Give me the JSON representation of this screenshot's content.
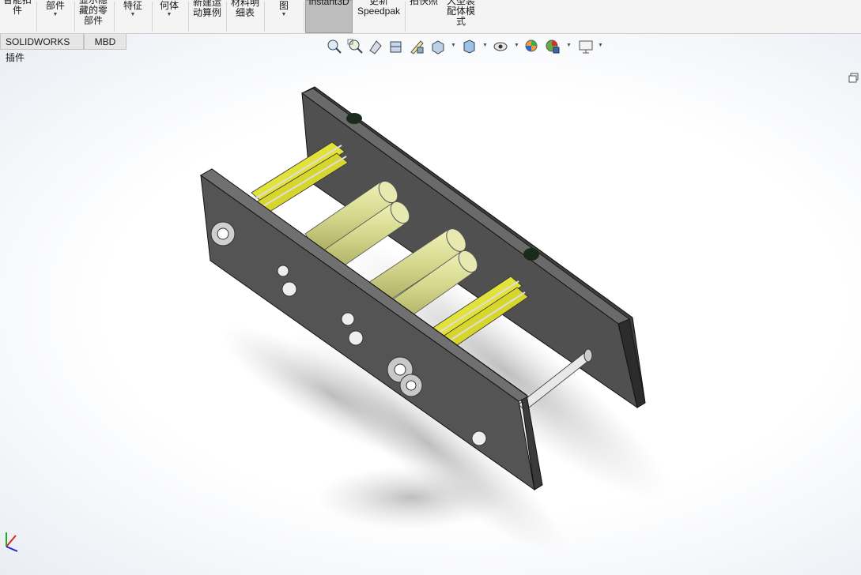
{
  "ribbon": {
    "items": [
      {
        "label": "智能扣\n件",
        "has_arrow": false
      },
      {
        "label": "部件",
        "has_arrow": true
      },
      {
        "label": "显示隐\n藏的零\n部件",
        "has_arrow": false
      },
      {
        "label": "特征",
        "has_arrow": true
      },
      {
        "label": "何体",
        "has_arrow": true
      },
      {
        "label": "新建运\n动算例",
        "has_arrow": false
      },
      {
        "label": "材料明\n细表",
        "has_arrow": false
      },
      {
        "label": "图",
        "has_arrow": true
      },
      {
        "label": "Instant3D",
        "has_arrow": false,
        "active": true
      },
      {
        "label": "更新\nSpeedpak",
        "has_arrow": false
      },
      {
        "label": "拍快照",
        "has_arrow": false
      },
      {
        "label": "大型装\n配体模\n式",
        "has_arrow": false
      }
    ]
  },
  "tabs": [
    {
      "label": "SOLIDWORKS 插件"
    },
    {
      "label": "MBD"
    }
  ],
  "heads_up_toolbar": {
    "icons": [
      "zoom-to-fit-icon",
      "zoom-to-area-icon",
      "previous-view-icon",
      "section-view-icon",
      "dynamic-annotation-icon",
      "view-orientation-icon",
      "display-style-icon",
      "hide-show-items-icon",
      "edit-appearance-icon",
      "apply-scene-icon",
      "view-settings-icon"
    ]
  },
  "colors": {
    "ribbon_bg": "#f4f4f4",
    "plate": "#4a4a4a",
    "roller": "#d7d98a",
    "sprocket": "#e2e23a"
  }
}
